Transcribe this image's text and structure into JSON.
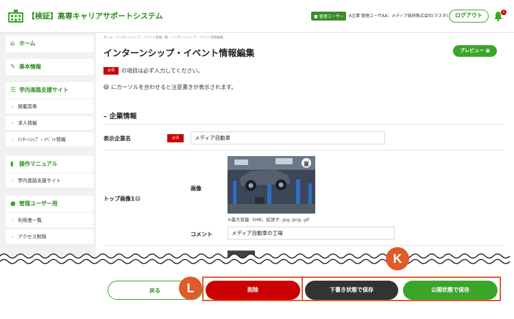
{
  "header": {
    "title": "【検証】高専キャリアサポートシステム",
    "admin_badge": "管理ユーザー",
    "user_info": "A企業 管理ユーザAA：メディア総研株式会社(マスタ)",
    "logout_label": "ログアウト",
    "notification_count": "1"
  },
  "sidebar": {
    "home": "ホーム",
    "basic_info": "基本情報",
    "campus_site": "学内進路支援サイト",
    "campus_items": [
      "掲載高専",
      "求人情報",
      "ｲﾝﾀｰﾝｼｯﾌﾟ・ｲﾍﾞﾝﾄ情報"
    ],
    "manual": "操作マニュアル",
    "manual_items": [
      "学内進路支援サイト"
    ],
    "admin": "管理ユーザー用",
    "admin_items": [
      "利用者一覧",
      "アクセス制限"
    ]
  },
  "main": {
    "breadcrumb": "ホーム・インターンシップ・イベント情報一覧・インターンシップ・イベント情報編集",
    "page_title": "インターンシップ・イベント情報編集",
    "preview_label": "プレビュー",
    "required_tag": "必須",
    "required_note": "の項目は必ず入力してください。",
    "hover_note": "にカーソルを合わせると注意書きが表示されます。",
    "section_title": "– 企業情報",
    "company_label": "表示企業名",
    "company_value": "メディア自動車",
    "top_image_label": "トップ画像1",
    "image_label": "画像",
    "image_note": "※最大容量: 5MB、拡張子: jpg, png, gif",
    "comment_label": "コメント",
    "comment_value": "メディア自動車の工場"
  },
  "footer": {
    "back_label": "戻る",
    "delete_label": "削除",
    "draft_label": "下書き状態で保存",
    "publish_label": "公開状態で保存",
    "callout_l": "L",
    "callout_k": "K"
  }
}
